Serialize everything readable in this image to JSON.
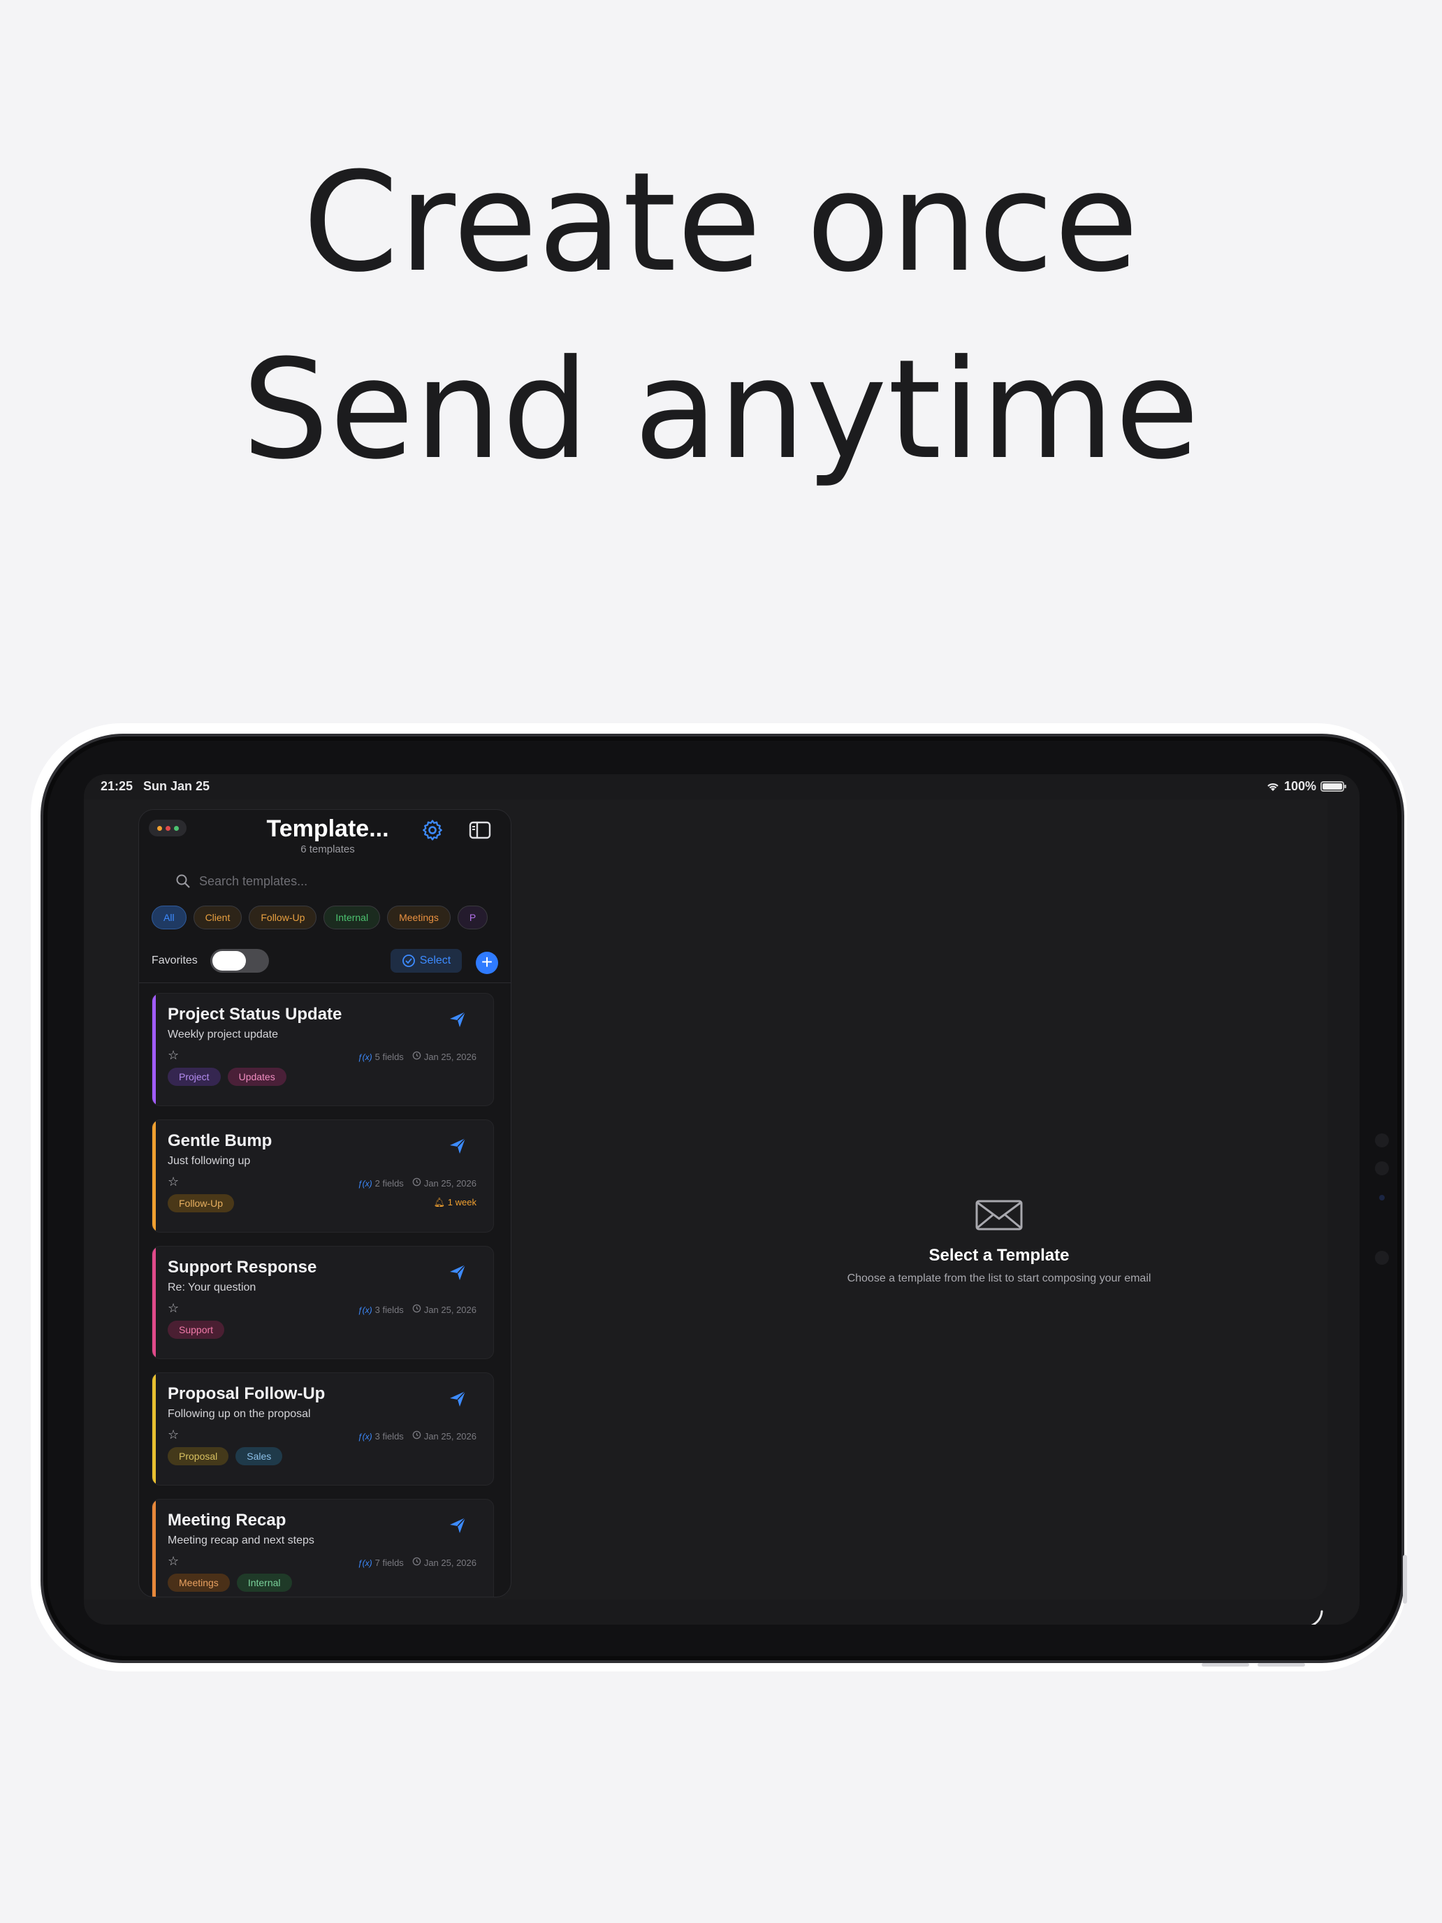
{
  "headline": {
    "line1": "Create once",
    "line2": "Send anytime"
  },
  "status_bar": {
    "time": "21:25",
    "date": "Sun Jan 25",
    "battery": "100%"
  },
  "sidebar": {
    "title": "Template...",
    "subtitle": "6 templates",
    "search_placeholder": "Search templates...",
    "chips": [
      {
        "label": "All",
        "color": "#3d8bff",
        "bg": "#1f3a63"
      },
      {
        "label": "Client",
        "color": "#e8a040",
        "bg": "#2d2418"
      },
      {
        "label": "Follow-Up",
        "color": "#e8a040",
        "bg": "#2d2418"
      },
      {
        "label": "Internal",
        "color": "#4cc270",
        "bg": "#1b2b1f"
      },
      {
        "label": "Meetings",
        "color": "#e89040",
        "bg": "#2d2418"
      },
      {
        "label": "P",
        "color": "#b070e8",
        "bg": "#241b2d"
      }
    ],
    "favorites_label": "Favorites",
    "select_label": "Select",
    "add_label": "+"
  },
  "templates": [
    {
      "title": "Project Status Update",
      "desc": "Weekly project update",
      "fields": "5 fields",
      "date": "Jan 25, 2026",
      "bar": "#a15cff",
      "tags": [
        {
          "label": "Project",
          "color": "#b48cf0",
          "bg": "#352650"
        },
        {
          "label": "Updates",
          "color": "#f08cc0",
          "bg": "#4a2038"
        }
      ]
    },
    {
      "title": "Gentle Bump",
      "desc": "Just following up",
      "fields": "2 fields",
      "date": "Jan 25, 2026",
      "bar": "#f0a030",
      "tags": [
        {
          "label": "Follow-Up",
          "color": "#e8b060",
          "bg": "#4a3818"
        }
      ],
      "reminder": "1 week"
    },
    {
      "title": "Support Response",
      "desc": "Re: Your question",
      "fields": "3 fields",
      "date": "Jan 25, 2026",
      "bar": "#e04a8a",
      "tags": [
        {
          "label": "Support",
          "color": "#f07aa8",
          "bg": "#4a1f32"
        }
      ]
    },
    {
      "title": "Proposal Follow-Up",
      "desc": "Following up on the proposal",
      "fields": "3 fields",
      "date": "Jan 25, 2026",
      "bar": "#e8c030",
      "tags": [
        {
          "label": "Proposal",
          "color": "#d8c060",
          "bg": "#44391a"
        },
        {
          "label": "Sales",
          "color": "#8cc0e8",
          "bg": "#1f3a4a"
        }
      ]
    },
    {
      "title": "Meeting Recap",
      "desc": "Meeting recap and next steps",
      "fields": "7 fields",
      "date": "Jan 25, 2026",
      "bar": "#e8883a",
      "tags": [
        {
          "label": "Meetings",
          "color": "#e8a060",
          "bg": "#4a3018"
        },
        {
          "label": "Internal",
          "color": "#7ad09a",
          "bg": "#1f3a28"
        }
      ]
    }
  ],
  "empty_state": {
    "title": "Select a Template",
    "subtitle": "Choose a template from the list to start composing your email"
  },
  "icons": [
    "gear-icon",
    "sidebar-toggle-icon",
    "search-icon",
    "checkmark-circle-icon",
    "send-icon",
    "star-icon",
    "clock-icon",
    "bell-icon",
    "envelope-icon",
    "wifi-icon"
  ],
  "colors": {
    "accent": "#3d8bff",
    "background": "#f4f4f6",
    "screen": "#1c1c1e"
  }
}
